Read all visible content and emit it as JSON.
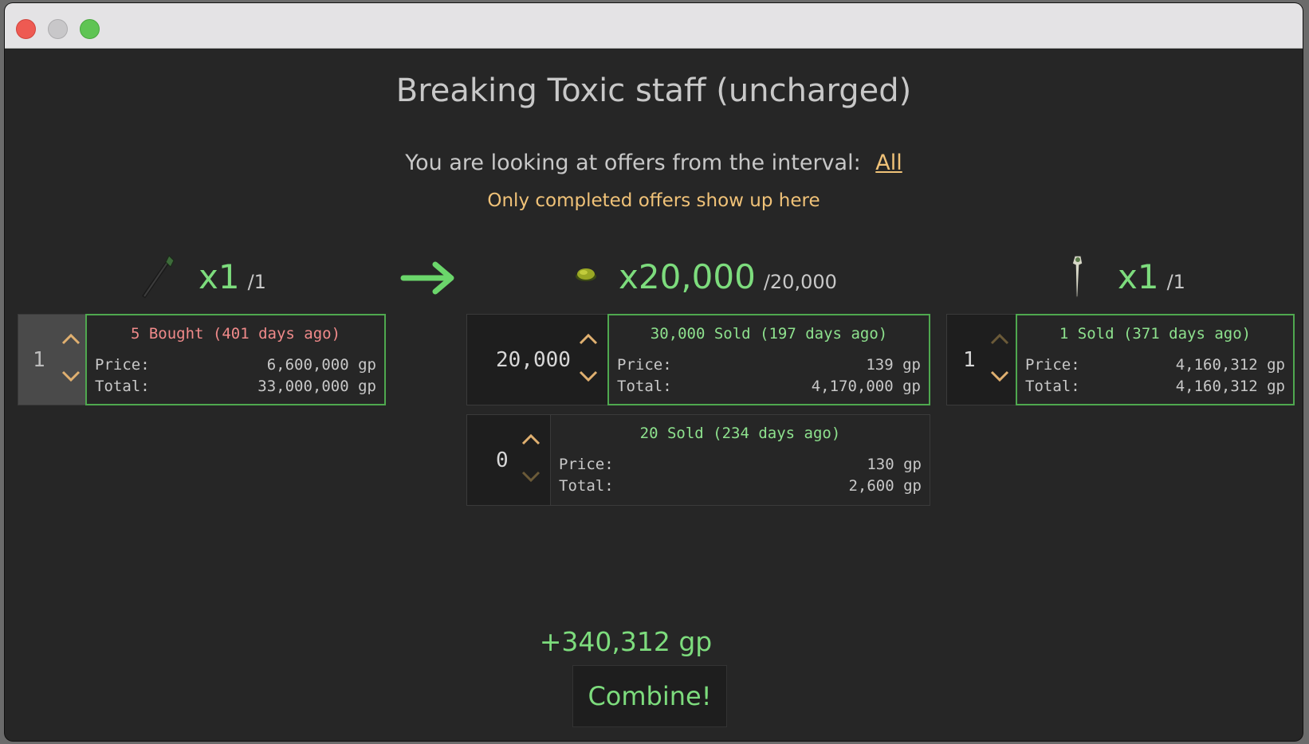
{
  "window": {
    "title": ""
  },
  "header": {
    "title": "Breaking Toxic staff (uncharged)",
    "interval_text": "You are looking at offers from the interval:",
    "interval_link": "All",
    "note": "Only completed offers show up here"
  },
  "input_item": {
    "name": "Toxic staff (uncharged)",
    "icon": "staff-icon",
    "qty": "x1",
    "qty_max": "/1",
    "stepper_value": "1",
    "offer": {
      "header": "5 Bought (401 days ago)",
      "price_label": "Price:",
      "price": "6,600,000 gp",
      "total_label": "Total:",
      "total": "33,000,000 gp"
    }
  },
  "output_item_1": {
    "icon": "scales-icon",
    "qty": "x20,000",
    "qty_max": "/20,000",
    "offers": [
      {
        "stepper_value": "20,000",
        "header": "30,000 Sold (197 days ago)",
        "price_label": "Price:",
        "price": "139 gp",
        "total_label": "Total:",
        "total": "4,170,000 gp"
      },
      {
        "stepper_value": "0",
        "header": "20 Sold (234 days ago)",
        "price_label": "Price:",
        "price": "130 gp",
        "total_label": "Total:",
        "total": "2,600 gp"
      }
    ]
  },
  "output_item_2": {
    "icon": "fang-icon",
    "qty": "x1",
    "qty_max": "/1",
    "stepper_value": "1",
    "offer": {
      "header": "1 Sold (371 days ago)",
      "price_label": "Price:",
      "price": "4,160,312 gp",
      "total_label": "Total:",
      "total": "4,160,312 gp"
    }
  },
  "result": {
    "profit": "+340,312 gp",
    "combine_label": "Combine!"
  },
  "colors": {
    "accent_green": "#7ddc7d",
    "accent_orange": "#f0c278",
    "bought_red": "#f08a8a",
    "border_green": "#4fa84f"
  }
}
